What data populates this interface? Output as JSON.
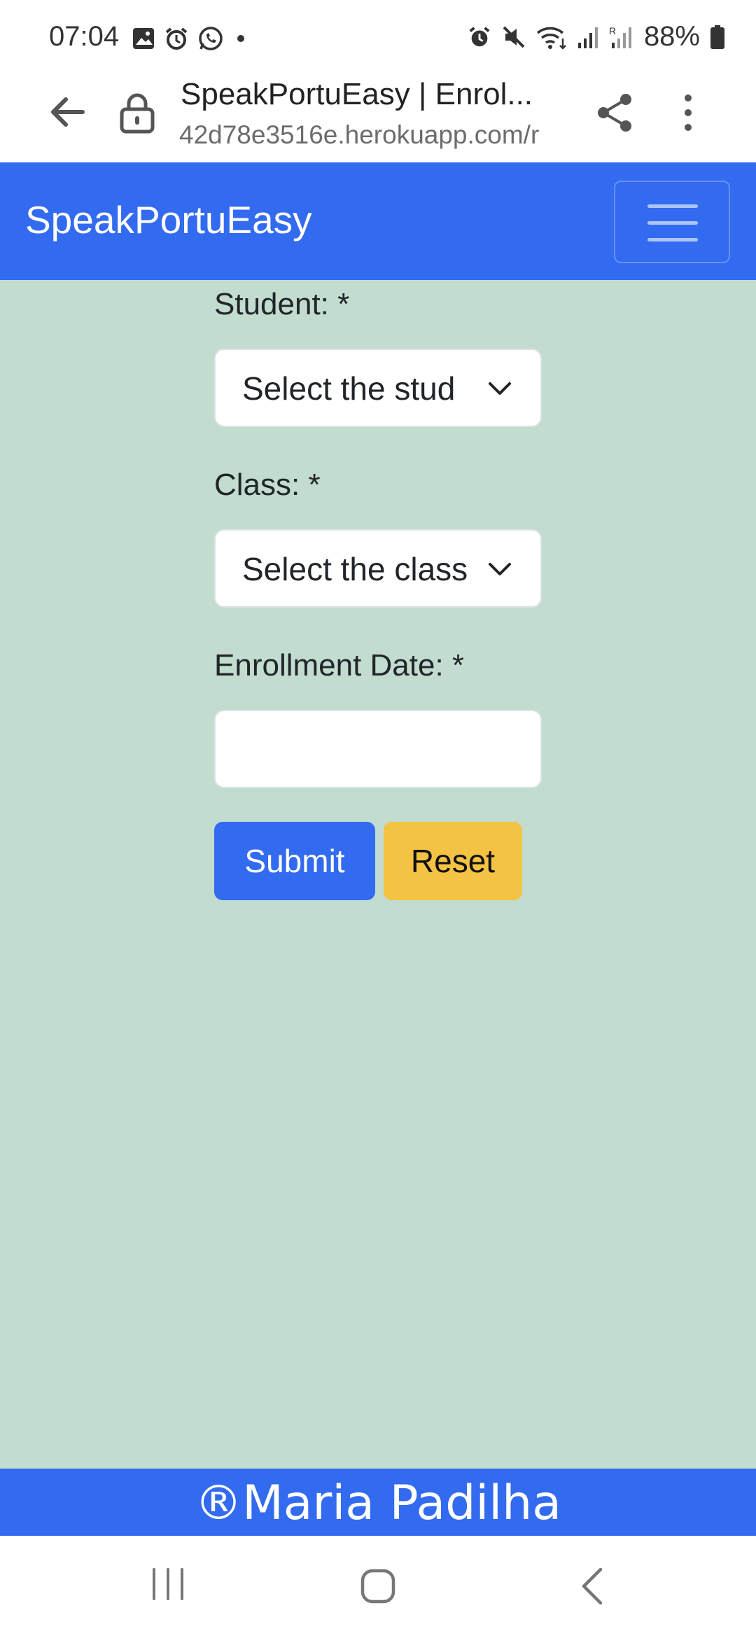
{
  "status_bar": {
    "time": "07:04",
    "battery": "88%",
    "left_icons": [
      "gallery-icon",
      "alarm-icon",
      "whatsapp-icon",
      "dot-icon"
    ],
    "right_icons": [
      "alarm-icon",
      "mute-icon",
      "wifi-icon",
      "signal-icon",
      "signal-roaming-icon",
      "battery-icon"
    ]
  },
  "browser": {
    "title": "SpeakPortuEasy | Enrol...",
    "url": "42d78e3516e.herokuapp.com/r"
  },
  "navbar": {
    "brand": "SpeakPortuEasy",
    "brand_color": "#336bf0"
  },
  "form": {
    "student_label": "Student: *",
    "student_value": "Select the stud",
    "class_label": "Class: *",
    "class_value": "Select the class",
    "date_label": "Enrollment Date: *",
    "date_value": "",
    "submit_label": "Submit",
    "reset_label": "Reset"
  },
  "footer": {
    "text": "®Maria Padilha"
  },
  "colors": {
    "page_bg": "#c2dcd0",
    "primary": "#336bf0",
    "warning": "#f5c344"
  }
}
